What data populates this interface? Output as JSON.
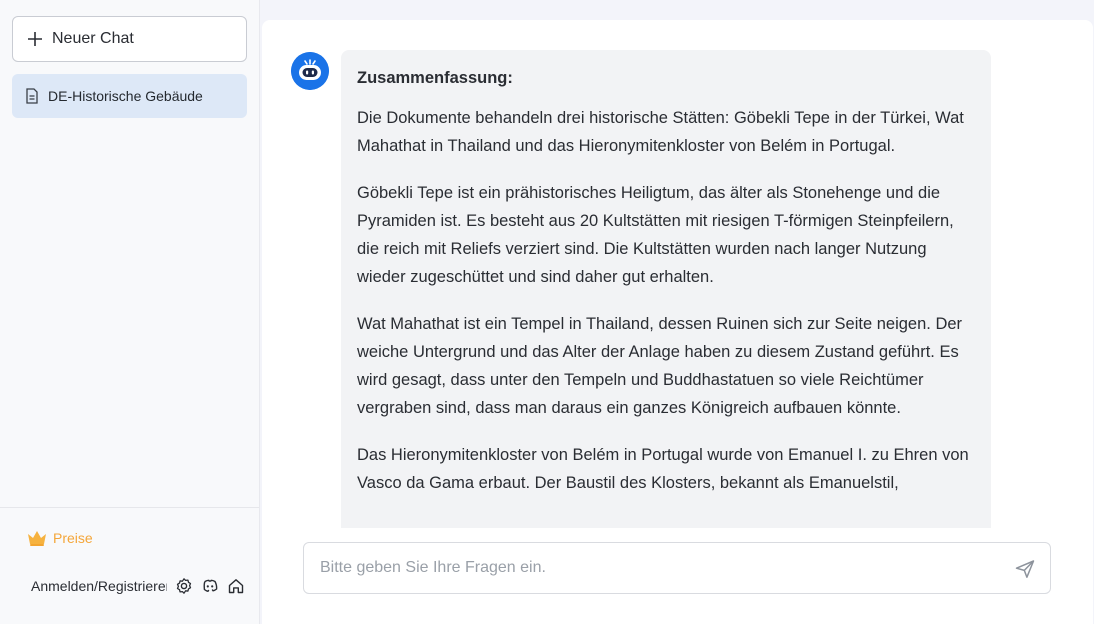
{
  "sidebar": {
    "new_chat_label": "Neuer Chat",
    "chats": [
      {
        "label": "DE-Historische Gebäude",
        "active": true
      }
    ],
    "pricing_label": "Preise",
    "login_label": "Anmelden/Registrieren"
  },
  "conversation": {
    "heading": "Zusammenfassung:",
    "paragraphs": [
      "Die Dokumente behandeln drei historische Stätten: Göbekli Tepe in der Türkei, Wat Mahathat in Thailand und das Hieronymitenkloster von Belém in Portugal.",
      "Göbekli Tepe ist ein prähistorisches Heiligtum, das älter als Stonehenge und die Pyramiden ist. Es besteht aus 20 Kultstätten mit riesigen T-förmigen Steinpfeilern, die reich mit Reliefs verziert sind. Die Kultstätten wurden nach langer Nutzung wieder zugeschüttet und sind daher gut erhalten.",
      "Wat Mahathat ist ein Tempel in Thailand, dessen Ruinen sich zur Seite neigen. Der weiche Untergrund und das Alter der Anlage haben zu diesem Zustand geführt. Es wird gesagt, dass unter den Tempeln und Buddhastatuen so viele Reichtümer vergraben sind, dass man daraus ein ganzes Königreich aufbauen könnte.",
      "Das Hieronymitenkloster von Belém in Portugal wurde von Emanuel I. zu Ehren von Vasco da Gama erbaut. Der Baustil des Klosters, bekannt als Emanuelstil,"
    ]
  },
  "input": {
    "placeholder": "Bitte geben Sie Ihre Fragen ein.",
    "value": ""
  },
  "icons": {
    "new_chat": "plus-icon",
    "chat_item": "document-icon",
    "pricing": "crown-icon",
    "footer": [
      "settings-icon",
      "discord-icon",
      "home-icon"
    ],
    "assistant": "robot-avatar-icon",
    "send": "send-icon"
  },
  "colors": {
    "accent": "#1a73e8",
    "active_chat_bg": "#dde8f7",
    "pricing": "#f4a63a",
    "bubble_bg": "#f2f3f5"
  }
}
